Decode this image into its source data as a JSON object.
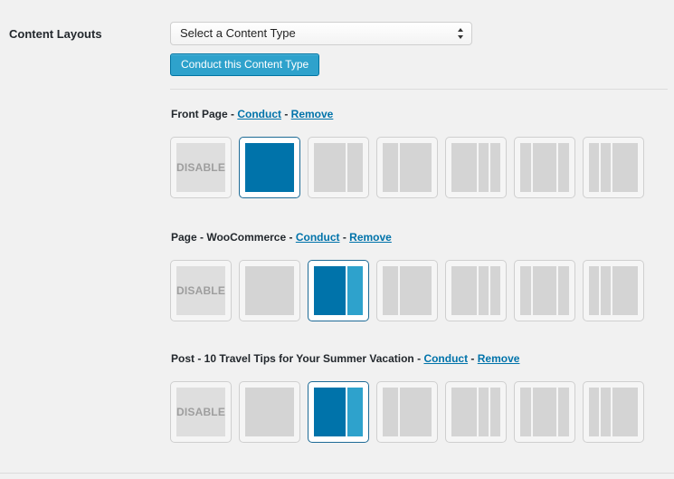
{
  "field_label": "Content Layouts",
  "select": {
    "value": "Select a Content Type"
  },
  "conduct_type_button": "Conduct this Content Type",
  "sections": [
    {
      "title": "Front Page",
      "sep1": " - ",
      "conduct": "Conduct",
      "sep2": " - ",
      "remove": "Remove",
      "selected": 1
    },
    {
      "title": "Page - WooCommerce",
      "sep1": " - ",
      "conduct": "Conduct",
      "sep2": " - ",
      "remove": "Remove",
      "selected": 2
    },
    {
      "title": "Post - 10 Travel Tips for Your Summer Vacation",
      "sep1": " - ",
      "conduct": "Conduct",
      "sep2": " - ",
      "remove": "Remove",
      "selected": 2
    }
  ],
  "layout_options": [
    {
      "name": "disable",
      "label": "DISABLE"
    },
    {
      "name": "full-width"
    },
    {
      "name": "content-sidebar"
    },
    {
      "name": "sidebar-content"
    },
    {
      "name": "content-sidebar-sidebar"
    },
    {
      "name": "sidebar-content-sidebar"
    },
    {
      "name": "sidebar-sidebar-content"
    }
  ],
  "colors": {
    "accent": "#0073aa",
    "accent_light": "#2ea2cc",
    "link": "#0073aa",
    "inactive": "#d4d4d4"
  }
}
